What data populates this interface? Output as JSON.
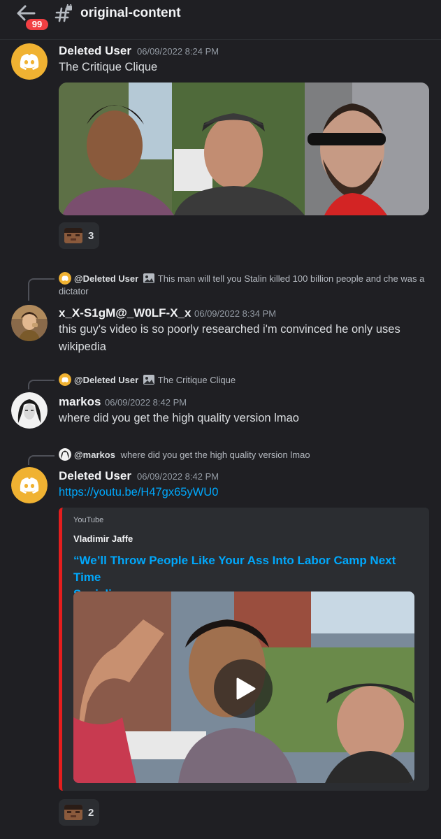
{
  "header": {
    "back_icon": "arrow-left-icon",
    "badge_count": "99",
    "channel_icon": "locked-hash-icon",
    "channel_name": "original-content"
  },
  "messages": [
    {
      "username": "Deleted User",
      "timestamp": "06/09/2022 8:24 PM",
      "text": "The Critique Clique",
      "reaction_count": "3"
    },
    {
      "reply_name": "@Deleted User",
      "reply_text_1": "This man will tell you Stalin killed 100 billion people and che was a",
      "reply_text_2": "dictator",
      "username": "x_X-S1gM@_W0LF-X_x",
      "timestamp": "06/09/2022 8:34 PM",
      "text_1": "this guy's video is so poorly researched i'm convinced he only uses",
      "text_2": "wikipedia"
    },
    {
      "reply_name": "@Deleted User",
      "reply_text": "The Critique Clique",
      "username": "markos",
      "timestamp": "06/09/2022 8:42 PM",
      "text": "where did you get the high quality version lmao"
    },
    {
      "reply_name": "@markos",
      "reply_text": "where did you get the high quality version lmao",
      "username": "Deleted User",
      "timestamp": "06/09/2022 8:42 PM",
      "link": "https://youtu.be/H47gx65yWU0",
      "reaction_count": "2"
    }
  ],
  "embed": {
    "provider": "YouTube",
    "author": "Vladimir Jaffe",
    "title_1": "“We’ll Throw People Like Your Ass Into Labor Camp Next Time",
    "title_2": "Sociali...",
    "accent_color": "#e41e1e",
    "play_icon": "play-icon"
  },
  "colors": {
    "background": "#1f1f23",
    "discord_avatar": "#f0b232",
    "link": "#00a8fc",
    "badge": "#f23f43"
  }
}
